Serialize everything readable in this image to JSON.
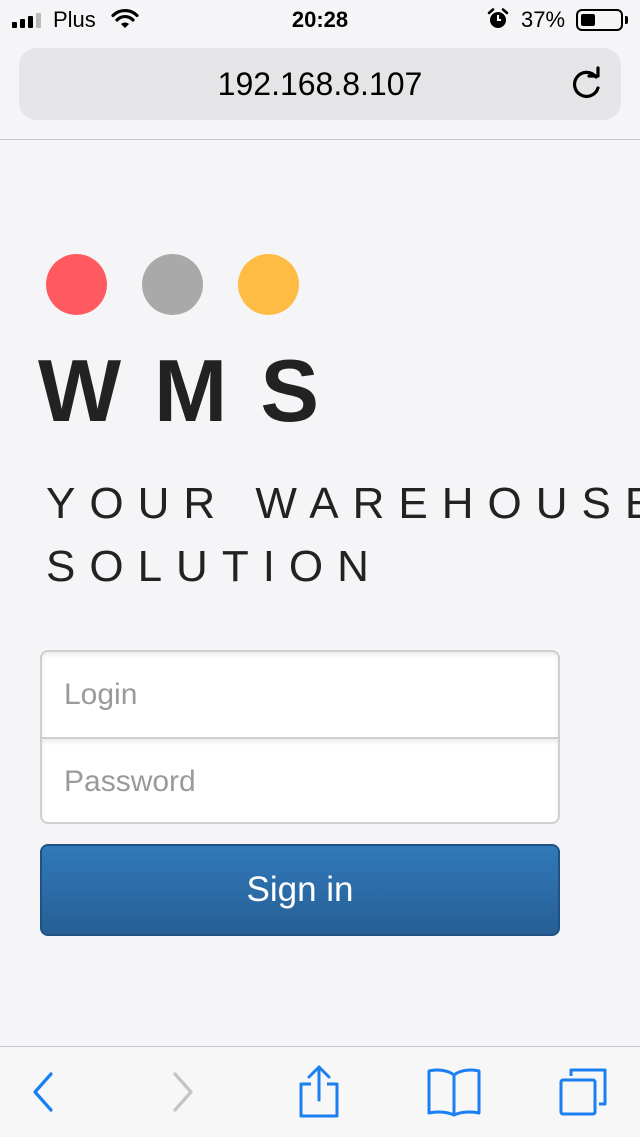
{
  "status_bar": {
    "carrier": "Plus",
    "time": "20:28",
    "battery_percent": "37%",
    "battery_level": 0.37,
    "icons": [
      "signal-icon",
      "wifi-icon",
      "alarm-icon",
      "battery-icon"
    ]
  },
  "browser": {
    "url": "192.168.8.107",
    "reload_icon": "reload-icon"
  },
  "logo": {
    "dot_colors": [
      "#ff5a5f",
      "#a9a9a9",
      "#ffbc45"
    ],
    "brand": "WMS",
    "tagline_line1": "YOUR WAREHOUSE",
    "tagline_line2": "SOLUTION"
  },
  "login_form": {
    "login_placeholder": "Login",
    "login_value": "",
    "password_placeholder": "Password",
    "password_value": "",
    "submit_label": "Sign in",
    "submit_color": "#2c6aa8"
  },
  "toolbar": {
    "icons": [
      "back-icon",
      "forward-icon",
      "share-icon",
      "bookmarks-icon",
      "tabs-icon"
    ],
    "accent": "#1a7ff0",
    "forward_enabled": false
  }
}
